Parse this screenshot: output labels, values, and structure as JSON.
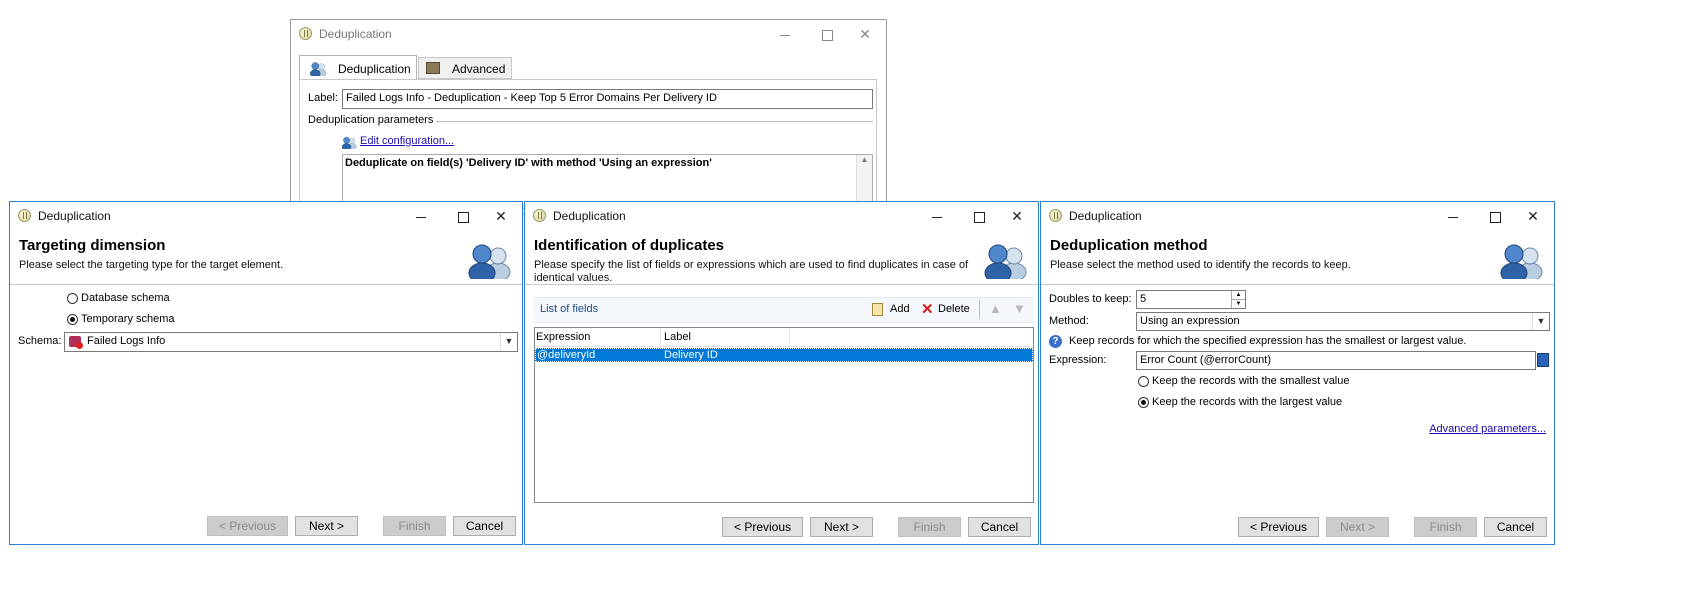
{
  "bg_window": {
    "title": "Deduplication",
    "tabs": [
      "Deduplication",
      "Advanced"
    ],
    "label_caption": "Label:",
    "label_value": "Failed Logs Info - Deduplication - Keep Top 5 Error Domains Per Delivery ID",
    "params_section": "Deduplication parameters",
    "edit_link": "Edit configuration...",
    "summary": "Deduplicate on field(s) 'Delivery ID' with method 'Using an expression'"
  },
  "win1": {
    "title": "Deduplication",
    "header_title": "Targeting dimension",
    "header_sub": "Please select the targeting type for the target element.",
    "radio_db": "Database schema",
    "radio_temp": "Temporary schema",
    "selected_radio": "temp",
    "schema_label": "Schema:",
    "schema_value": "Failed Logs Info",
    "buttons": {
      "previous": "< Previous",
      "next": "Next >",
      "finish": "Finish",
      "cancel": "Cancel"
    }
  },
  "win2": {
    "title": "Deduplication",
    "header_title": "Identification of duplicates",
    "header_sub": "Please specify the list of fields or expressions which are used to find duplicates in case of identical values.",
    "list_title": "List of fields",
    "add": "Add",
    "delete": "Delete",
    "columns": [
      "Expression",
      "Label"
    ],
    "rows": [
      {
        "expression": "@deliveryId",
        "label": "Delivery ID",
        "selected": true
      }
    ],
    "buttons": {
      "previous": "< Previous",
      "next": "Next >",
      "finish": "Finish",
      "cancel": "Cancel"
    }
  },
  "win3": {
    "title": "Deduplication",
    "header_title": "Deduplication method",
    "header_sub": "Please select the method used to identify the records to keep.",
    "doubles_label": "Doubles to keep:",
    "doubles_value": "5",
    "method_label": "Method:",
    "method_value": "Using an expression",
    "help_text": "Keep records for which the specified expression has the smallest or largest value.",
    "expression_label": "Expression:",
    "expression_value": "Error Count (@errorCount)",
    "radio_smallest": "Keep the records with the smallest value",
    "radio_largest": "Keep the records with the largest value",
    "selected_radio": "largest",
    "advanced_link": "Advanced parameters...",
    "buttons": {
      "previous": "< Previous",
      "next": "Next >",
      "finish": "Finish",
      "cancel": "Cancel"
    }
  },
  "colors": {
    "selection": "#0078d7",
    "window_border": "#2b7fd4",
    "link": "#1a0dab"
  }
}
